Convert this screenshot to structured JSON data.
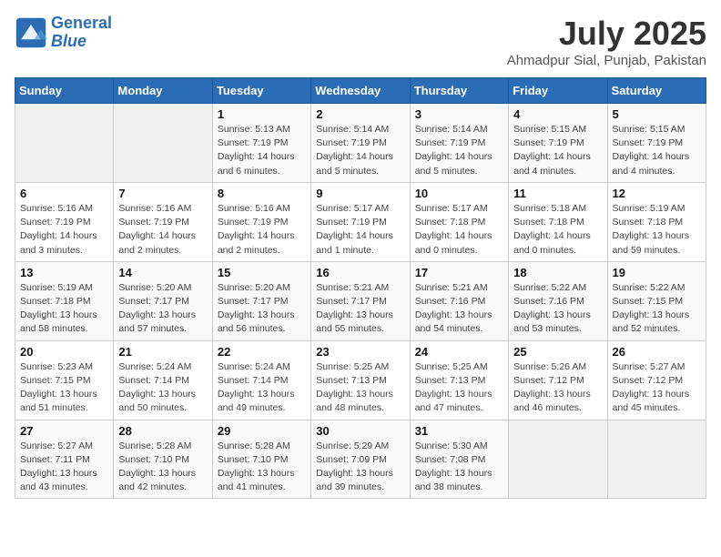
{
  "header": {
    "logo_line1": "General",
    "logo_line2": "Blue",
    "title": "July 2025",
    "subtitle": "Ahmadpur Sial, Punjab, Pakistan"
  },
  "days_of_week": [
    "Sunday",
    "Monday",
    "Tuesday",
    "Wednesday",
    "Thursday",
    "Friday",
    "Saturday"
  ],
  "weeks": [
    [
      {
        "day": "",
        "info": ""
      },
      {
        "day": "",
        "info": ""
      },
      {
        "day": "1",
        "info": "Sunrise: 5:13 AM\nSunset: 7:19 PM\nDaylight: 14 hours and 6 minutes."
      },
      {
        "day": "2",
        "info": "Sunrise: 5:14 AM\nSunset: 7:19 PM\nDaylight: 14 hours and 5 minutes."
      },
      {
        "day": "3",
        "info": "Sunrise: 5:14 AM\nSunset: 7:19 PM\nDaylight: 14 hours and 5 minutes."
      },
      {
        "day": "4",
        "info": "Sunrise: 5:15 AM\nSunset: 7:19 PM\nDaylight: 14 hours and 4 minutes."
      },
      {
        "day": "5",
        "info": "Sunrise: 5:15 AM\nSunset: 7:19 PM\nDaylight: 14 hours and 4 minutes."
      }
    ],
    [
      {
        "day": "6",
        "info": "Sunrise: 5:16 AM\nSunset: 7:19 PM\nDaylight: 14 hours and 3 minutes."
      },
      {
        "day": "7",
        "info": "Sunrise: 5:16 AM\nSunset: 7:19 PM\nDaylight: 14 hours and 2 minutes."
      },
      {
        "day": "8",
        "info": "Sunrise: 5:16 AM\nSunset: 7:19 PM\nDaylight: 14 hours and 2 minutes."
      },
      {
        "day": "9",
        "info": "Sunrise: 5:17 AM\nSunset: 7:19 PM\nDaylight: 14 hours and 1 minute."
      },
      {
        "day": "10",
        "info": "Sunrise: 5:17 AM\nSunset: 7:18 PM\nDaylight: 14 hours and 0 minutes."
      },
      {
        "day": "11",
        "info": "Sunrise: 5:18 AM\nSunset: 7:18 PM\nDaylight: 14 hours and 0 minutes."
      },
      {
        "day": "12",
        "info": "Sunrise: 5:19 AM\nSunset: 7:18 PM\nDaylight: 13 hours and 59 minutes."
      }
    ],
    [
      {
        "day": "13",
        "info": "Sunrise: 5:19 AM\nSunset: 7:18 PM\nDaylight: 13 hours and 58 minutes."
      },
      {
        "day": "14",
        "info": "Sunrise: 5:20 AM\nSunset: 7:17 PM\nDaylight: 13 hours and 57 minutes."
      },
      {
        "day": "15",
        "info": "Sunrise: 5:20 AM\nSunset: 7:17 PM\nDaylight: 13 hours and 56 minutes."
      },
      {
        "day": "16",
        "info": "Sunrise: 5:21 AM\nSunset: 7:17 PM\nDaylight: 13 hours and 55 minutes."
      },
      {
        "day": "17",
        "info": "Sunrise: 5:21 AM\nSunset: 7:16 PM\nDaylight: 13 hours and 54 minutes."
      },
      {
        "day": "18",
        "info": "Sunrise: 5:22 AM\nSunset: 7:16 PM\nDaylight: 13 hours and 53 minutes."
      },
      {
        "day": "19",
        "info": "Sunrise: 5:22 AM\nSunset: 7:15 PM\nDaylight: 13 hours and 52 minutes."
      }
    ],
    [
      {
        "day": "20",
        "info": "Sunrise: 5:23 AM\nSunset: 7:15 PM\nDaylight: 13 hours and 51 minutes."
      },
      {
        "day": "21",
        "info": "Sunrise: 5:24 AM\nSunset: 7:14 PM\nDaylight: 13 hours and 50 minutes."
      },
      {
        "day": "22",
        "info": "Sunrise: 5:24 AM\nSunset: 7:14 PM\nDaylight: 13 hours and 49 minutes."
      },
      {
        "day": "23",
        "info": "Sunrise: 5:25 AM\nSunset: 7:13 PM\nDaylight: 13 hours and 48 minutes."
      },
      {
        "day": "24",
        "info": "Sunrise: 5:25 AM\nSunset: 7:13 PM\nDaylight: 13 hours and 47 minutes."
      },
      {
        "day": "25",
        "info": "Sunrise: 5:26 AM\nSunset: 7:12 PM\nDaylight: 13 hours and 46 minutes."
      },
      {
        "day": "26",
        "info": "Sunrise: 5:27 AM\nSunset: 7:12 PM\nDaylight: 13 hours and 45 minutes."
      }
    ],
    [
      {
        "day": "27",
        "info": "Sunrise: 5:27 AM\nSunset: 7:11 PM\nDaylight: 13 hours and 43 minutes."
      },
      {
        "day": "28",
        "info": "Sunrise: 5:28 AM\nSunset: 7:10 PM\nDaylight: 13 hours and 42 minutes."
      },
      {
        "day": "29",
        "info": "Sunrise: 5:28 AM\nSunset: 7:10 PM\nDaylight: 13 hours and 41 minutes."
      },
      {
        "day": "30",
        "info": "Sunrise: 5:29 AM\nSunset: 7:09 PM\nDaylight: 13 hours and 39 minutes."
      },
      {
        "day": "31",
        "info": "Sunrise: 5:30 AM\nSunset: 7:08 PM\nDaylight: 13 hours and 38 minutes."
      },
      {
        "day": "",
        "info": ""
      },
      {
        "day": "",
        "info": ""
      }
    ]
  ]
}
